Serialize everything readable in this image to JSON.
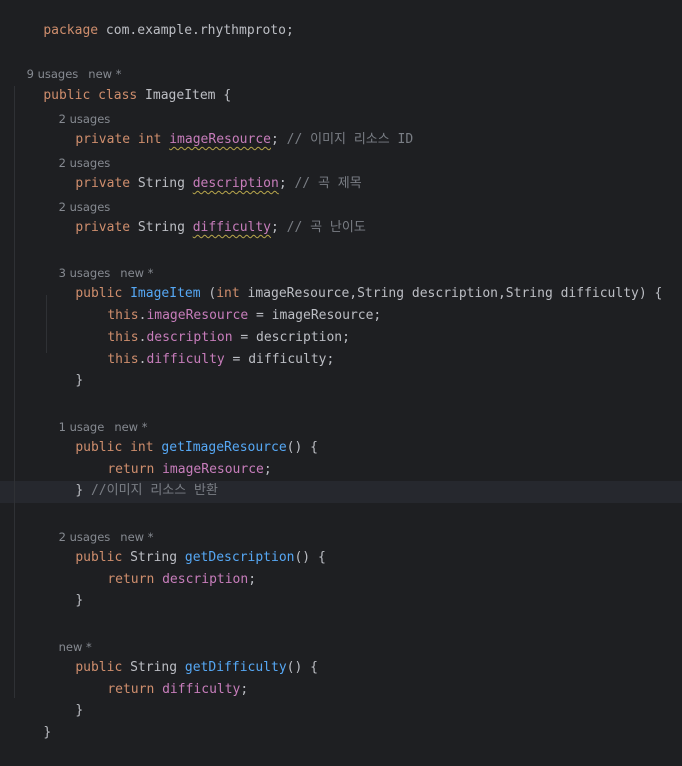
{
  "editor": {
    "package_line": {
      "kw": "package",
      "name": " com.example.rhythmproto;"
    },
    "class_hint": {
      "usages": "9 usages",
      "new": "new *"
    },
    "class_decl": {
      "kw": "public class",
      "name": " ImageItem {"
    },
    "fields": [
      {
        "hint": "2 usages",
        "mods": "private int",
        "name": "imageResource",
        "semi": ";",
        "comment": " // 이미지 리소스 ID"
      },
      {
        "hint": "2 usages",
        "mods": "private",
        "type": " String ",
        "name": "description",
        "semi": ";",
        "comment": " // 곡 제목"
      },
      {
        "hint": "2 usages",
        "mods": "private",
        "type": " String ",
        "name": "difficulty",
        "semi": ";",
        "comment": " // 곡 난이도"
      }
    ],
    "constructor": {
      "hint_usages": "3 usages",
      "hint_new": "new *",
      "kw": "public",
      "name": "ImageItem",
      "open": " (",
      "int_kw": "int",
      "params": " imageResource,String description,String difficulty) {",
      "body": [
        {
          "this": "this",
          "dot": ".",
          "field": "imageResource",
          "rest": " = imageResource;"
        },
        {
          "this": "this",
          "dot": ".",
          "field": "description",
          "rest": " = description;"
        },
        {
          "this": "this",
          "dot": ".",
          "field": "difficulty",
          "rest": " = difficulty;"
        }
      ],
      "close": "}"
    },
    "getImageResource": {
      "hint_usages": "1 usage",
      "hint_new": "new *",
      "kw": "public int",
      "name": "getImageResource",
      "sig": "() {",
      "ret": "return",
      "field": "imageResource",
      "semi": ";",
      "close": "}",
      "comment": " //이미지 리소스 반환"
    },
    "getDescription": {
      "hint_usages": "2 usages",
      "hint_new": "new *",
      "kw": "public",
      "type": " String ",
      "name": "getDescription",
      "sig": "() {",
      "ret": "return",
      "field": "description",
      "semi": ";",
      "close": "}"
    },
    "getDifficulty": {
      "hint_new": "new *",
      "kw": "public",
      "type": " String ",
      "name": "getDifficulty",
      "sig": "() {",
      "ret": "return",
      "field": "difficulty",
      "semi": ";",
      "close": "}"
    },
    "class_close": "}"
  }
}
